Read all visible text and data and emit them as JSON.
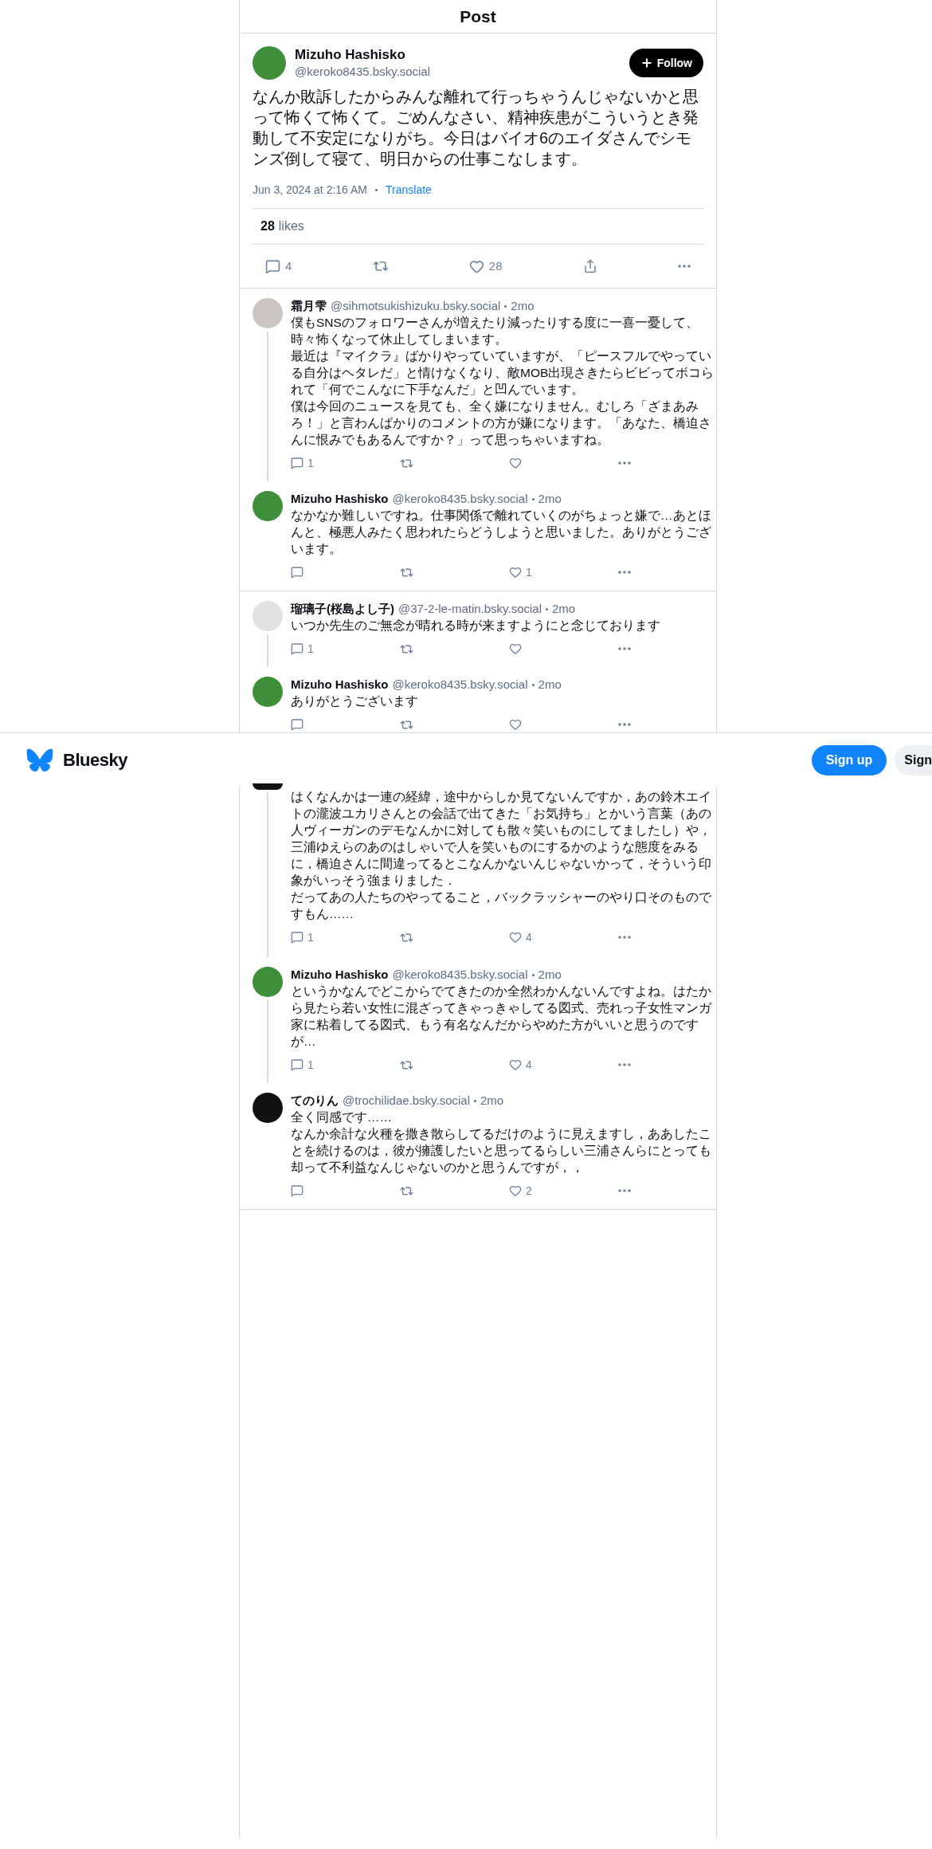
{
  "header": {
    "title": "Post"
  },
  "post": {
    "author": {
      "name": "Mizuho Hashisko",
      "handle": "@keroko8435.bsky.social",
      "color": "#3f8f3a"
    },
    "follow_button": "Follow",
    "text": "なんか敗訴したからみんな離れて行っちゃうんじゃないかと思って怖くて怖くて。ごめんなさい、精神疾患がこういうとき発動して不安定になりがち。今日はバイオ6のエイダさんでシモンズ倒して寝て、明日からの仕事こなします。",
    "timestamp": "Jun 3, 2024 at 2:16 AM",
    "translate": "Translate",
    "likes": {
      "count": "28",
      "label": "likes"
    },
    "actions": {
      "replies": "4",
      "likes": "28"
    }
  },
  "threads": [
    {
      "clipped": false,
      "replies": [
        {
          "kind": "full",
          "name": "霜月雫",
          "handle": "@sihmotsukishizuku.bsky.social",
          "time": "2mo",
          "color": "#c9c6c4",
          "paragraphs": [
            "僕もSNSのフォロワーさんが増えたり減ったりする度に一喜一憂して、時々怖くなって休止してしまいます。",
            "最近は『マイクラ』ばかりやっていていますが、「ピースフルでやっている自分はヘタレだ」と情けなくなり、敵MOB出現さきたらビビってボコられて「何でこんなに下手なんだ」と凹んでいます。",
            "僕は今回のニュースを見ても、全く嫌になりません。むしろ「ざまあみろ！」と言わんばかりのコメントの方が嫌になります。「あなた、橋迫さんに恨みでもあるんですか？」って思っちゃいますね。"
          ],
          "replies": "1"
        },
        {
          "kind": "full",
          "name": "Mizuho Hashisko",
          "handle": "@keroko8435.bsky.social",
          "time": "2mo",
          "color": "#3f8f3a",
          "paragraphs": [
            "なかなか難しいですね。仕事関係で離れていくのがちょっと嫌で…あとほんと、極悪人みたく思われたらどうしようと思いました。ありがとうございます。"
          ],
          "likes": "1"
        }
      ]
    },
    {
      "clipped": true,
      "replies": [
        {
          "kind": "full",
          "name": "瑠璃子(桜島よし子)",
          "handle": "@37-2-le-matin.bsky.social",
          "time": "2mo",
          "color": "#e4e2e0",
          "paragraphs": [
            "いつか先生のご無念が晴れる時が来ますようにと念じております"
          ],
          "replies": "1"
        },
        {
          "kind": "full",
          "name": "Mizuho Hashisko",
          "handle": "@keroko8435.bsky.social",
          "time": "2mo",
          "color": "#3f8f3a",
          "paragraphs": [
            "ありがとうございます"
          ]
        }
      ]
    },
    {
      "clipped": false,
      "replies": [
        {
          "kind": "partial",
          "color": "#111111",
          "paragraphs": [
            "はくなんかは一連の経緯，途中からしか見てないんですか，あの鈴木エイトの瀧波ユカリさんとの会話で出てきた「お気持ち」とかいう言葉（あの人ヴィーガンのデモなんかに対しても散々笑いものにしてましたし）や，三浦ゆえらのあのはしゃいで人を笑いものにするかのような態度をみるに，橋迫さんに間違ってるとこなんかないんじゃないかって，そういう印象がいっそう強まりました．",
            "だってあの人たちのやってること，バックラッシャーのやり口そのものですもん……"
          ],
          "replies": "1",
          "likes": "4"
        },
        {
          "kind": "full",
          "name": "Mizuho Hashisko",
          "handle": "@keroko8435.bsky.social",
          "time": "2mo",
          "color": "#3f8f3a",
          "paragraphs": [
            "というかなんでどこからでてきたのか全然わかんないんですよね。はたから見たら若い女性に混ざってきゃっきゃしてる図式、売れっ子女性マンガ家に粘着してる図式、もう有名なんだからやめた方がいいと思うのですが…"
          ],
          "replies": "1",
          "likes": "4"
        },
        {
          "kind": "full",
          "name": "てのりん",
          "handle": "@trochilidae.bsky.social",
          "time": "2mo",
          "color": "#111111",
          "paragraphs": [
            "全く同感です……",
            "なんか余計な火種を撒き散らしてるだけのように見えますし，ああしたことを続けるのは，彼が擁護したいと思ってるらしい三浦さんらにとっても却って不利益なんじゃないのかと思うんですが，，"
          ],
          "likes": "2"
        }
      ]
    }
  ],
  "banner": {
    "brand": "Bluesky",
    "signup": "Sign up",
    "signin": "Sign"
  }
}
